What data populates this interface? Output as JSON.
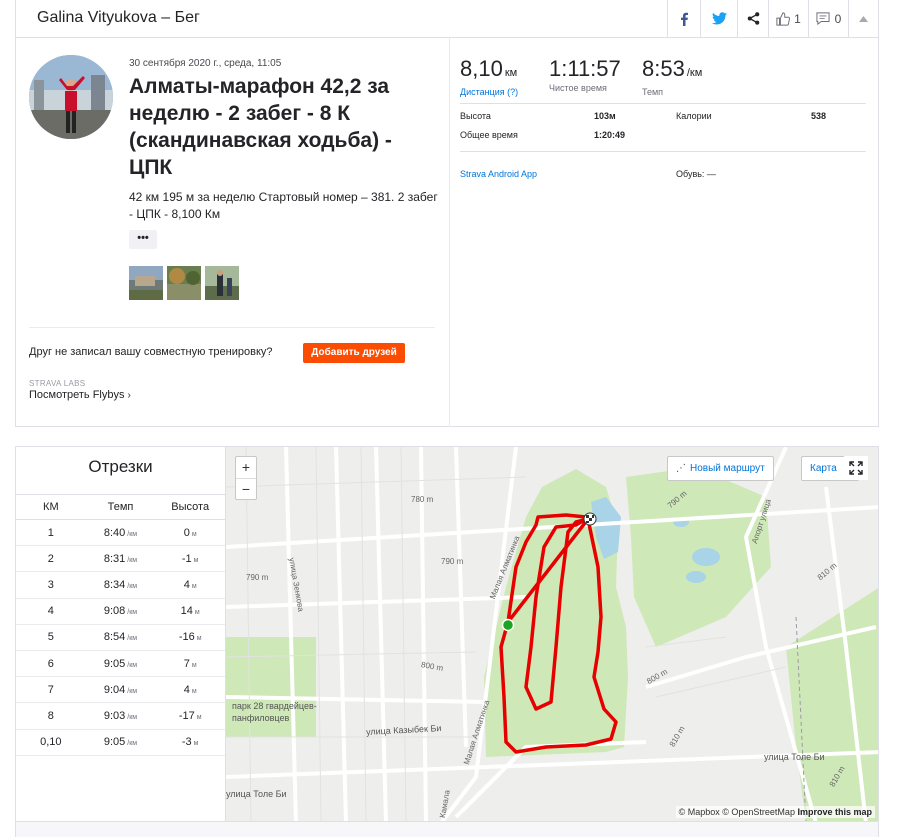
{
  "header": {
    "title": "Galina Vityukova – Бег",
    "kudos_count": "1",
    "comments_count": "0"
  },
  "activity": {
    "date": "30 сентября 2020 г., среда, 11:05",
    "title": "Алматы-марафон 42,2 за неделю - 2 забег - 8 К (скандинавская ходьба) - ЦПК",
    "description": "42 км 195 м за неделю Стартовый номер – 381. 2 забег - ЦПК - 8,100 Км",
    "more_label": "•••",
    "friend_prompt": "Друг не записал вашу совместную тренировку?",
    "add_friends_label": "Добавить друзей",
    "labs_label": "STRAVA LABS",
    "flybys_label": "Посмотреть Flybys"
  },
  "stats": {
    "distance": "8,10",
    "distance_unit": "км",
    "distance_label": "Дистанция (?)",
    "moving_time": "1:11:57",
    "moving_time_label": "Чистое время",
    "pace": "8:53",
    "pace_unit": "/км",
    "pace_label": "Темп",
    "elevation_label": "Высота",
    "elevation_value": "103м",
    "calories_label": "Калории",
    "calories_value": "538",
    "elapsed_label": "Общее время",
    "elapsed_value": "1:20:49",
    "device": "Strava Android App",
    "shoes": "Обувь: —"
  },
  "splits": {
    "title": "Отрезки",
    "headers": [
      "КМ",
      "Темп",
      "Высота"
    ],
    "pace_unit": "/км",
    "elev_unit": "м",
    "rows": [
      {
        "km": "1",
        "pace": "8:40",
        "elev": "0"
      },
      {
        "km": "2",
        "pace": "8:31",
        "elev": "-1"
      },
      {
        "km": "3",
        "pace": "8:34",
        "elev": "4"
      },
      {
        "km": "4",
        "pace": "9:08",
        "elev": "14"
      },
      {
        "km": "5",
        "pace": "8:54",
        "elev": "-16"
      },
      {
        "km": "6",
        "pace": "9:05",
        "elev": "7"
      },
      {
        "km": "7",
        "pace": "9:04",
        "elev": "4"
      },
      {
        "km": "8",
        "pace": "9:03",
        "elev": "-17"
      },
      {
        "km": "0,10",
        "pace": "9:05",
        "elev": "-3"
      }
    ]
  },
  "map": {
    "zoom_in": "+",
    "zoom_out": "−",
    "new_route_label": "Новый маршрут",
    "map_type_label": "Карта",
    "attribution_a": "© Mapbox © OpenStreetMap",
    "attribution_b": "Improve this map",
    "labels": {
      "l780a": "780 m",
      "l780b": "780 m",
      "l790a": "790 m",
      "l790b": "790 m",
      "l800a": "800 m",
      "l800b": "800 m",
      "l810a": "810 m",
      "l810b": "810 m",
      "l810c": "810 m",
      "zenkova": "улица Зенкова",
      "malaya1": "Малая Алматинка",
      "malaya2": "Малая Алматинка",
      "aport": "Апорт улица",
      "gvard1": "парк 28 гвардейцев-",
      "gvard2": "панфиловцев",
      "kazybek": "улица Казыбек Би",
      "tole1": "улица Толе Би",
      "tole2": "улица Толе Би",
      "kamala": "Камала"
    },
    "colors": {
      "route": "#e60000",
      "park": "#cfe8b8",
      "water": "#a9d3e6"
    }
  }
}
